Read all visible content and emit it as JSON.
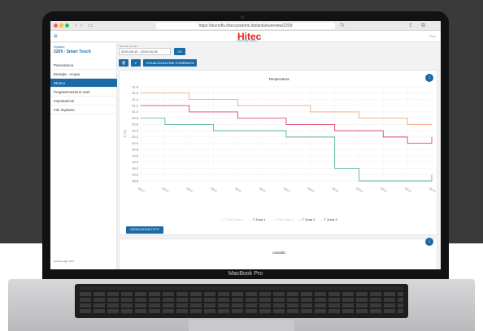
{
  "browser": {
    "url": "https://tecnoflu.hitecsystems.it/plants/overview/2209"
  },
  "app": {
    "logo": "Hitec",
    "logo_sub": "smart energy systems",
    "login_label": "Esci"
  },
  "sidebar": {
    "site_label": "Impianto",
    "site_name": "2209 - Smart Touch",
    "items": [
      {
        "label": "Panoramica"
      },
      {
        "label": "Energia - Acqua"
      },
      {
        "label": "Storico"
      },
      {
        "label": "Programmazione orari"
      },
      {
        "label": "Impostazioni"
      },
      {
        "label": "Info impianto"
      }
    ],
    "version": "versione app: 3.8.1"
  },
  "toolbar": {
    "date_label": "Intervallo periodo",
    "date_value": "2022-09-10 - 2022-09-15",
    "ok_label": "OK",
    "combined_label": "VISUALIZZAZIONE COMBINATA"
  },
  "card": {
    "deselect_label": "DESELEZIONA TUTTI"
  },
  "card2": {
    "title": "Umidità"
  },
  "laptop": {
    "model": "MacBook Pro"
  },
  "chart_data": {
    "type": "line",
    "title": "Temperatura",
    "ylabel": "T (°C)",
    "ylim": [
      21.9,
      21.8
    ],
    "yticks": [
      21.8,
      21.6,
      21.4,
      21.2,
      21.0,
      20.8,
      20.6,
      20.4,
      20.2,
      20.0,
      19.8,
      19.6,
      19.4,
      19.2,
      19.0,
      18.8
    ],
    "x": [
      "09/10",
      "09/10",
      "09/11",
      "09/11",
      "09/12",
      "09/12",
      "09/13",
      "09/13",
      "09/14",
      "09/14",
      "09/15",
      "09/15",
      "09/15"
    ],
    "series": [
      {
        "name": "T Set Zona 1",
        "color": "#bdbdbd",
        "visible": false,
        "values": []
      },
      {
        "name": "T Zona 1",
        "color": "#f4a37f",
        "values": [
          21.6,
          21.6,
          21.4,
          21.4,
          21.2,
          21.2,
          21.2,
          21.0,
          21.0,
          20.8,
          20.8,
          20.6,
          20.6
        ]
      },
      {
        "name": "T Set Zona 3",
        "color": "#bdbdbd",
        "visible": false,
        "values": []
      },
      {
        "name": "T Zona 2",
        "color": "#d9486b",
        "values": [
          21.2,
          21.2,
          21.0,
          21.0,
          20.8,
          20.8,
          20.6,
          20.6,
          20.4,
          20.4,
          20.2,
          20.0,
          20.2
        ]
      },
      {
        "name": "T Zona 3",
        "color": "#5bb59a",
        "values": [
          20.8,
          20.6,
          20.6,
          20.4,
          20.4,
          20.4,
          20.2,
          20.2,
          19.2,
          18.8,
          18.8,
          18.8,
          19.0
        ]
      }
    ]
  }
}
